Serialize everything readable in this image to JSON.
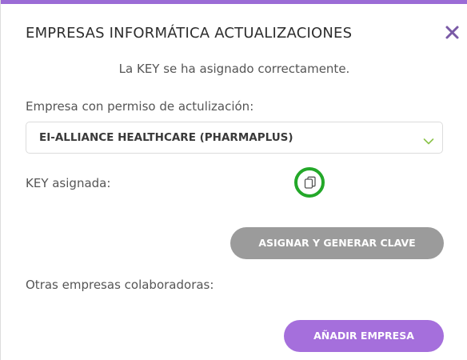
{
  "modal": {
    "title": "EMPRESAS INFORMÁTICA ACTUALIZACIONES",
    "close_icon": "close-icon",
    "status_message": "La KEY se ha asignado correctamente.",
    "accent_color": "#9b6cd6"
  },
  "company_field": {
    "label": "Empresa con permiso de actulización:",
    "selected_value": "EI-ALLIANCE HEALTHCARE (PHARMAPLUS)",
    "chevron_icon": "chevron-down-icon",
    "chevron_color": "#8bc34a"
  },
  "key_field": {
    "label": "KEY asignada:",
    "copy_icon": "copy-icon",
    "highlight_color": "#23a829"
  },
  "actions": {
    "generate_label": "ASIGNAR Y GENERAR CLAVE",
    "generate_color": "#9b9b9b",
    "add_company_label": "AÑADIR EMPRESA",
    "add_company_color": "#a56fdc"
  },
  "collaborators": {
    "label": "Otras empresas colaboradoras:"
  }
}
